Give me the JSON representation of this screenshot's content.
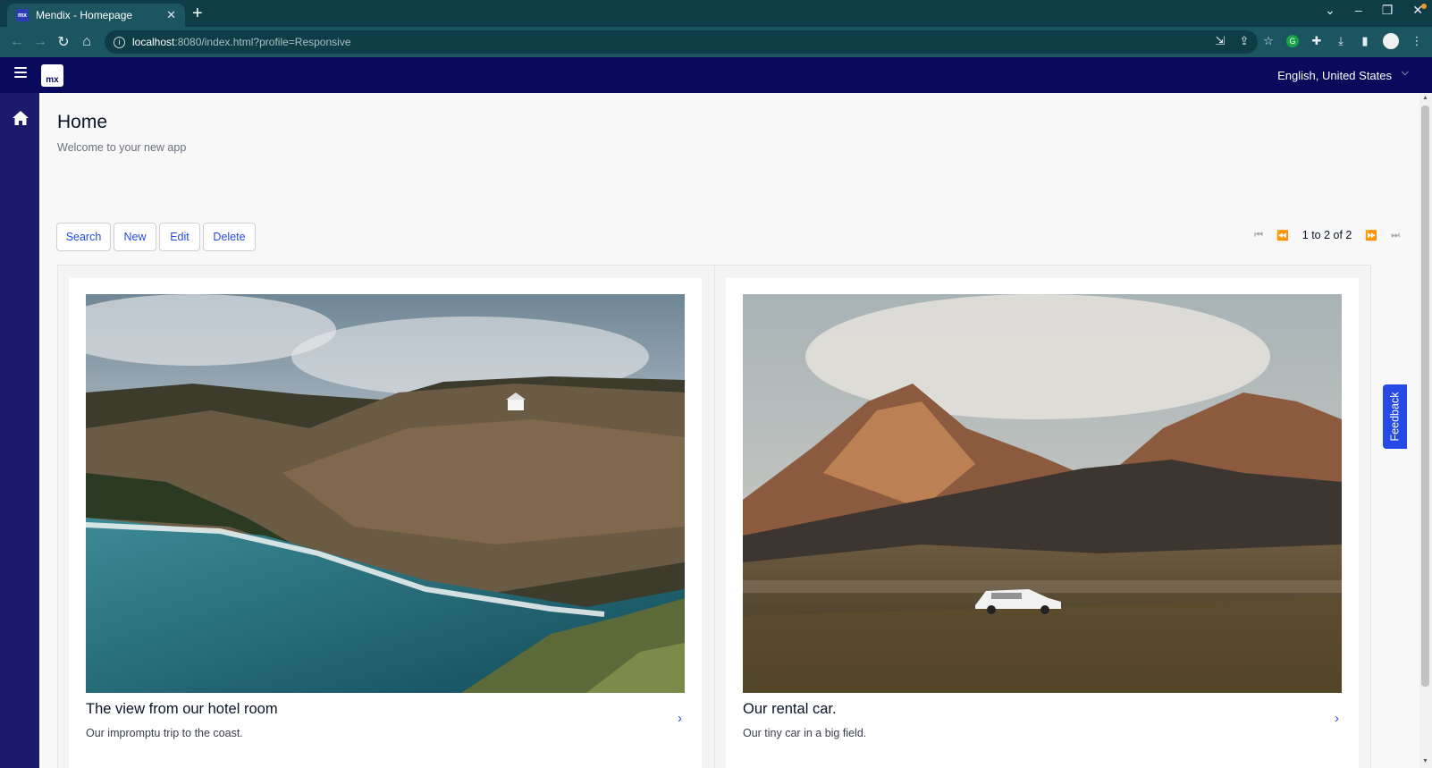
{
  "browser": {
    "tab_title": "Mendix - Homepage",
    "favicon_text": "mx",
    "close_glyph": "✕",
    "new_tab_glyph": "+",
    "url_host": "localhost",
    "url_rest": ":8080/index.html?profile=Responsive",
    "controls": {
      "tab_search": "⌄",
      "minimize": "–",
      "restore": "❐",
      "close": "✕"
    }
  },
  "app": {
    "logo_text": "mx",
    "language": "English, United States",
    "language_chevron": "⌵"
  },
  "page": {
    "title": "Home",
    "subtitle": "Welcome to your new app"
  },
  "toolbar": {
    "search_label": "Search",
    "new_label": "New",
    "edit_label": "Edit",
    "delete_label": "Delete"
  },
  "pager": {
    "first": "⏮",
    "prev": "⏪",
    "status": "1 to 2 of 2",
    "next": "⏩",
    "last": "⏭"
  },
  "cards": [
    {
      "title": "The view from our hotel room",
      "description": "Our impromptu trip to the coast.",
      "chevron": "›",
      "image": "coastal-cliffs-photo"
    },
    {
      "title": "Our rental car.",
      "description": "Our tiny car in a big field.",
      "chevron": "›",
      "image": "mountain-field-car-photo"
    }
  ],
  "feedback_label": "Feedback",
  "colors": {
    "app_header": "#0a0a5c",
    "sidebar": "#1c1a6b",
    "accent": "#264ae5",
    "browser_chrome": "#0f3d47"
  }
}
